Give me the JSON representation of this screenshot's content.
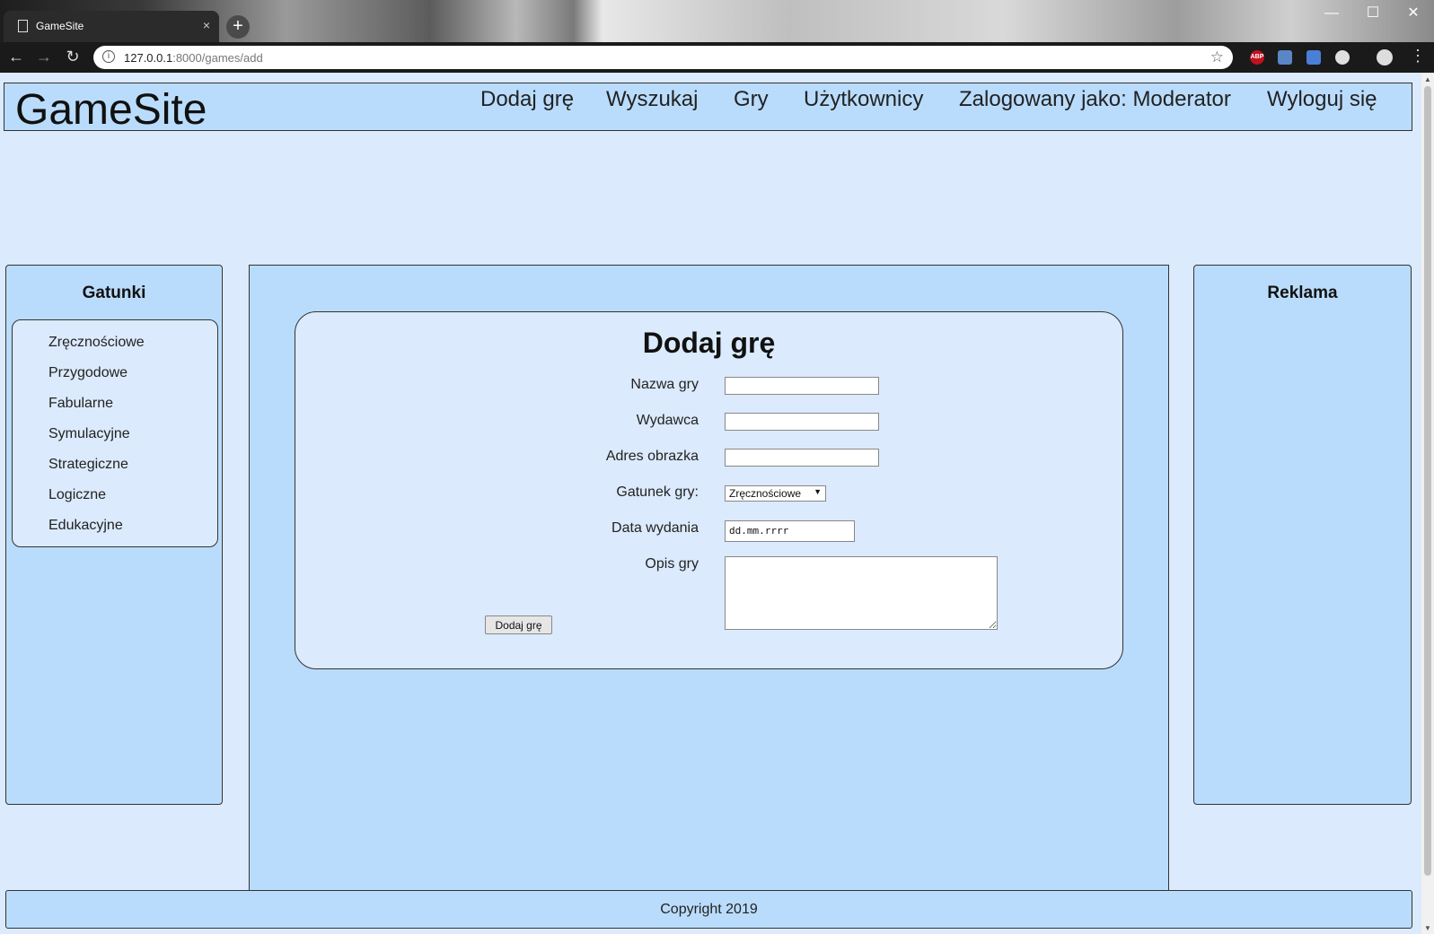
{
  "browser": {
    "tab_title": "GameSite",
    "tab_close": "×",
    "new_tab": "+",
    "url_host": "127.0.0.1",
    "url_rest": ":8000/games/add",
    "extensions": [
      "ABP"
    ],
    "window_controls": {
      "minimize": "—",
      "maximize": "☐",
      "close": "✕"
    },
    "nav": {
      "back": "←",
      "forward": "→",
      "reload": "↻",
      "star": "☆",
      "menu": "⋮"
    }
  },
  "header": {
    "logo": "GameSite",
    "nav": [
      "Dodaj grę",
      "Wyszukaj",
      "Gry",
      "Użytkownicy",
      "Zalogowany jako: Moderator",
      "Wyloguj się"
    ]
  },
  "sidebar": {
    "title": "Gatunki",
    "items": [
      "Zręcznościowe",
      "Przygodowe",
      "Fabularne",
      "Symulacyjne",
      "Strategiczne",
      "Logiczne",
      "Edukacyjne"
    ]
  },
  "ads": {
    "title": "Reklama"
  },
  "form": {
    "title": "Dodaj grę",
    "labels": {
      "name": "Nazwa gry",
      "publisher": "Wydawca",
      "image": "Adres obrazka",
      "genre": "Gatunek gry:",
      "date": "Data wydania",
      "description": "Opis gry"
    },
    "values": {
      "name": "",
      "publisher": "",
      "image": "",
      "genre": "Zręcznościowe",
      "date_placeholder": "dd.mm.rrrr",
      "description": ""
    },
    "submit": "Dodaj grę"
  },
  "footer": {
    "text": "Copyright 2019"
  }
}
